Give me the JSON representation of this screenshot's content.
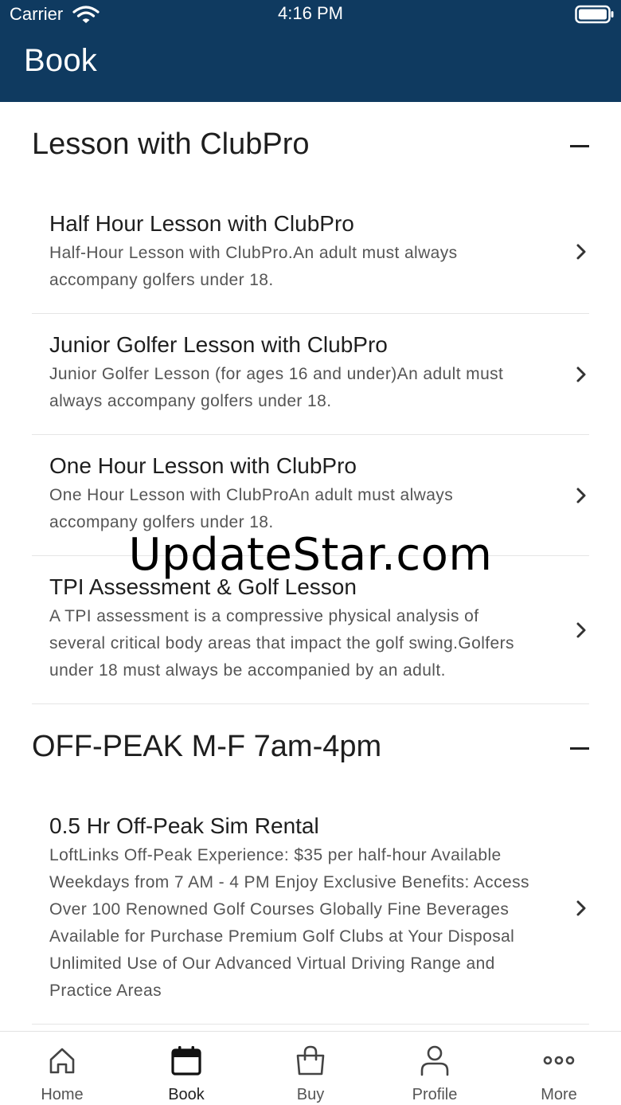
{
  "status_bar": {
    "carrier": "Carrier",
    "time": "4:16 PM"
  },
  "header": {
    "title": "Book"
  },
  "sections": [
    {
      "title": "Lesson with ClubPro",
      "items": [
        {
          "title": "Half Hour Lesson with ClubPro",
          "desc_lines": [
            "Half-Hour Lesson with ClubPro.An adult must always",
            "accompany golfers under 18."
          ]
        },
        {
          "title": "Junior Golfer Lesson with ClubPro",
          "desc_lines": [
            "Junior Golfer Lesson (for ages 16 and under)An adult must",
            "always accompany golfers under 18."
          ]
        },
        {
          "title": "One Hour Lesson with ClubPro",
          "desc_lines": [
            "One Hour Lesson with ClubProAn adult must always",
            "accompany golfers under 18."
          ]
        },
        {
          "title": "TPI Assessment & Golf Lesson",
          "desc_lines": [
            "A TPI assessment is a compressive physical analysis of",
            "several critical body areas that impact the golf swing.Golfers",
            "under 18 must always be accompanied by an adult."
          ]
        }
      ]
    },
    {
      "title": "OFF-PEAK M-F 7am-4pm",
      "items": [
        {
          "title": "0.5 Hr Off-Peak Sim Rental",
          "desc_lines": [
            "LoftLinks Off-Peak Experience: $35 per half-hour Available",
            "Weekdays from 7 AM - 4 PM Enjoy Exclusive Benefits: Access",
            "Over 100 Renowned Golf Courses Globally Fine Beverages",
            "Available for Purchase Premium Golf Clubs at Your Disposal",
            "Unlimited Use of Our Advanced Virtual Driving Range and",
            "Practice Areas"
          ]
        }
      ]
    }
  ],
  "watermark": "UpdateStar.com",
  "tabbar": {
    "active": "Book",
    "tabs": [
      {
        "label": "Home",
        "icon": "home-icon"
      },
      {
        "label": "Book",
        "icon": "calendar-icon"
      },
      {
        "label": "Buy",
        "icon": "shopping-bag-icon"
      },
      {
        "label": "Profile",
        "icon": "person-icon"
      },
      {
        "label": "More",
        "icon": "more-dots-icon"
      }
    ]
  },
  "colors": {
    "header_bg": "#0f3a60",
    "text": "#1e1e1e",
    "muted": "#555555"
  }
}
